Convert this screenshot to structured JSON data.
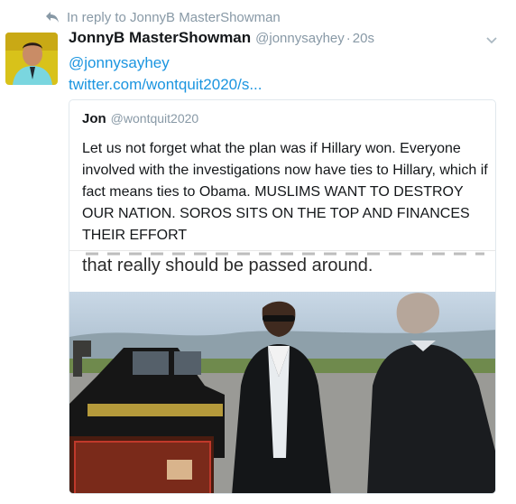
{
  "reply_context": {
    "icon": "reply-arrow-icon",
    "text": "In reply to JonnyB MasterShowman"
  },
  "tweet": {
    "avatar": "profile-photo",
    "display_name": "JonnyB MasterShowman",
    "handle": "@jonnysayhey",
    "separator": "·",
    "time": "20s",
    "menu_icon": "chevron-down-icon",
    "mention": "@jonnysayhey",
    "link": "twitter.com/wontquit2020/s..."
  },
  "quote": {
    "display_name": "Jon",
    "handle": "@wontquit2020",
    "text": "Let us not forget what the plan was if Hillary won. Everyone involved with the investigations now have ties to Hillary, which if fact means ties to Obama. MUSLIMS WANT TO DESTROY OUR NATION. SOROS SITS ON THE TOP AND FINANCES THEIR EFFORT",
    "media_caption": "that really should be passed around."
  },
  "colors": {
    "link": "#1b95e0",
    "muted": "#8899a6",
    "border": "#e1e8ed",
    "text": "#14171a"
  }
}
